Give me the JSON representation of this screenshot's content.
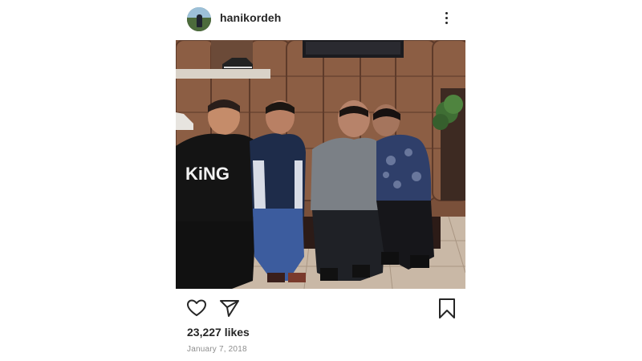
{
  "post": {
    "username": "hanikordeh",
    "likes": "23,227 likes",
    "date": "January 7, 2018",
    "shirt_text": "KiNG"
  },
  "icons": {
    "more": "more-options-icon",
    "like": "heart-icon",
    "share": "send-icon",
    "save": "bookmark-icon"
  },
  "colors": {
    "text": "#262626",
    "muted": "#8e8e8e",
    "background": "#ffffff"
  }
}
